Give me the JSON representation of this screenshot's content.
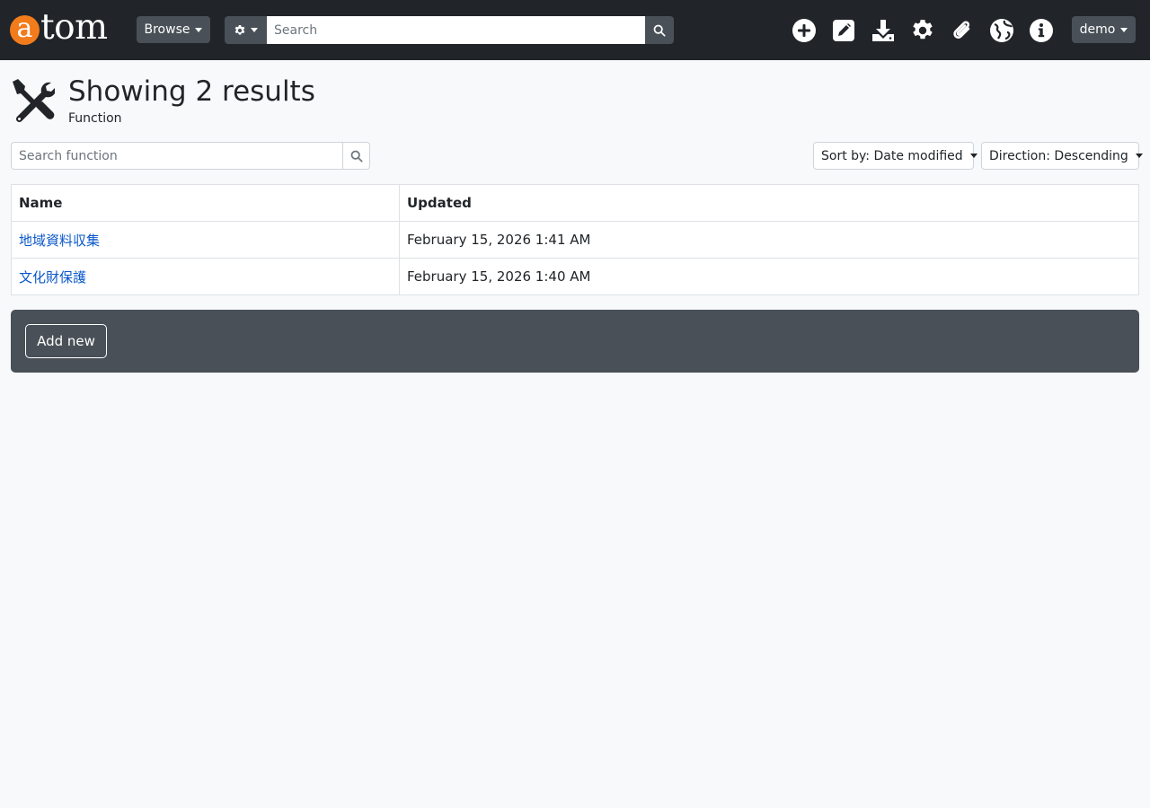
{
  "navbar": {
    "logo_first": "a",
    "logo_rest": "tom",
    "browse_label": "Browse",
    "search_placeholder": "Search",
    "icons": [
      "add-icon",
      "edit-icon",
      "import-icon",
      "settings-icon",
      "clipboard-icon",
      "language-icon",
      "info-icon"
    ],
    "user_label": "demo"
  },
  "page": {
    "title": "Showing 2 results",
    "subtitle": "Function",
    "icon": "tools-icon"
  },
  "filters": {
    "search_placeholder": "Search function",
    "sort_label": "Sort by: Date modified",
    "direction_label": "Direction: Descending"
  },
  "table": {
    "columns": [
      "Name",
      "Updated"
    ],
    "rows": [
      {
        "name": "地域資料収集",
        "updated": "February 15, 2026 1:41 AM"
      },
      {
        "name": "文化財保護",
        "updated": "February 15, 2026 1:40 AM"
      }
    ]
  },
  "actions": {
    "add_label": "Add new"
  },
  "colors": {
    "navbar_bg": "#212529",
    "logo_accent": "#f27b1b",
    "button_bg": "#495057",
    "link": "#0a58ca",
    "page_bg": "#f8f9fa"
  }
}
